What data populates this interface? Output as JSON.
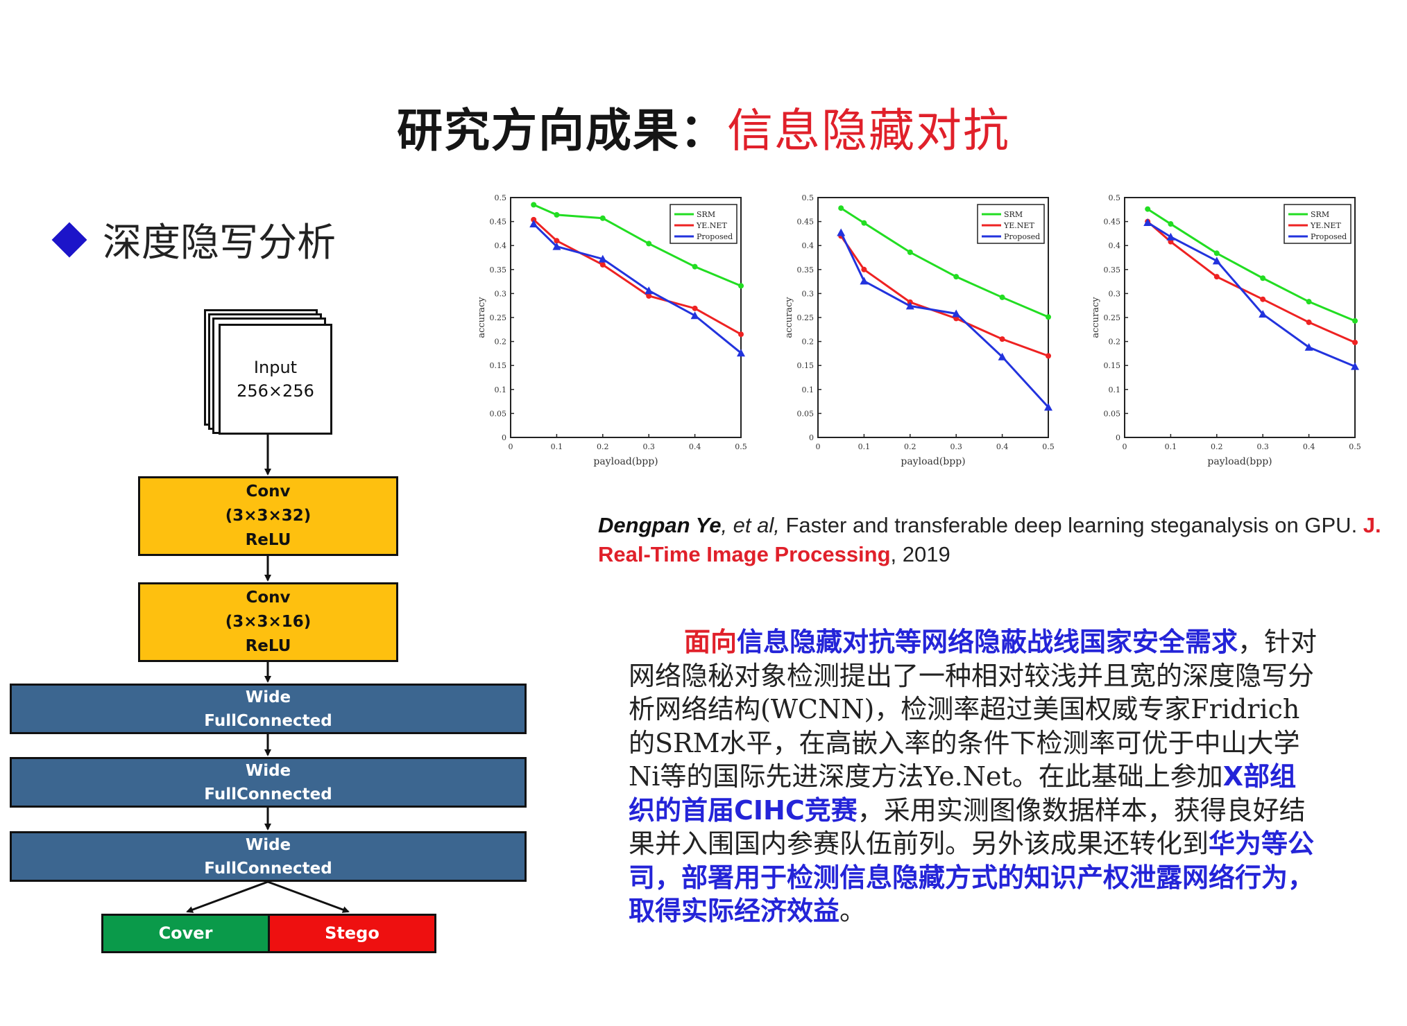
{
  "title": {
    "part1": "研究方向成果：",
    "part2": "信息隐藏对抗"
  },
  "section_heading": "深度隐写分析",
  "colors": {
    "title_red": "#e0202a",
    "bullet_blue": "#1c14c9",
    "conv_yellow": "#fec00f",
    "fc_blue": "#3c6690",
    "cover_green": "#0a9a4a",
    "stego_red": "#ee1010",
    "highlight_blue": "#2424d8"
  },
  "diagram": {
    "input": {
      "line1": "Input",
      "line2": "256×256"
    },
    "conv1": {
      "line1": "Conv",
      "line2": "(3×3×32)",
      "line3": "ReLU"
    },
    "conv2": {
      "line1": "Conv",
      "line2": "(3×3×16)",
      "line3": "ReLU"
    },
    "fc": [
      {
        "line1": "Wide",
        "line2": "FullConnected"
      },
      {
        "line1": "Wide",
        "line2": "FullConnected"
      },
      {
        "line1": "Wide",
        "line2": "FullConnected"
      }
    ],
    "outputs": {
      "cover": "Cover",
      "stego": "Stego"
    }
  },
  "chart_data": [
    {
      "type": "line",
      "xlabel": "payload(bpp)",
      "ylabel": "accuracy",
      "xlim": [
        0,
        0.5
      ],
      "ylim": [
        0,
        0.5
      ],
      "x_ticks": [
        "0",
        "0.1",
        "0.2",
        "0.3",
        "0.4",
        "0.5"
      ],
      "y_ticks": [
        "0",
        "0.05",
        "0.1",
        "0.15",
        "0.2",
        "0.25",
        "0.3",
        "0.35",
        "0.4",
        "0.45",
        "0.5"
      ],
      "legend_position": "top-right",
      "x": [
        0.05,
        0.1,
        0.2,
        0.3,
        0.4,
        0.5
      ],
      "series": [
        {
          "name": "SRM",
          "color": "#22dd22",
          "values": [
            0.485,
            0.464,
            0.457,
            0.404,
            0.356,
            0.316
          ]
        },
        {
          "name": "YE.NET",
          "color": "#ee2222",
          "values": [
            0.454,
            0.41,
            0.36,
            0.295,
            0.269,
            0.215
          ]
        },
        {
          "name": "Proposed",
          "color": "#2233dd",
          "values": [
            0.445,
            0.398,
            0.372,
            0.306,
            0.254,
            0.176
          ]
        }
      ]
    },
    {
      "type": "line",
      "xlabel": "payload(bpp)",
      "ylabel": "accuracy",
      "xlim": [
        0,
        0.5
      ],
      "ylim": [
        0,
        0.5
      ],
      "x_ticks": [
        "0",
        "0.1",
        "0.2",
        "0.3",
        "0.4",
        "0.5"
      ],
      "y_ticks": [
        "0",
        "0.05",
        "0.1",
        "0.15",
        "0.2",
        "0.25",
        "0.3",
        "0.35",
        "0.4",
        "0.45",
        "0.5"
      ],
      "legend_position": "top-right",
      "x": [
        0.05,
        0.1,
        0.2,
        0.3,
        0.4,
        0.5
      ],
      "series": [
        {
          "name": "SRM",
          "color": "#22dd22",
          "values": [
            0.478,
            0.447,
            0.386,
            0.335,
            0.292,
            0.251
          ]
        },
        {
          "name": "YE.NET",
          "color": "#ee2222",
          "values": [
            0.42,
            0.35,
            0.282,
            0.248,
            0.205,
            0.17
          ]
        },
        {
          "name": "Proposed",
          "color": "#2233dd",
          "values": [
            0.427,
            0.326,
            0.274,
            0.258,
            0.168,
            0.063
          ]
        }
      ]
    },
    {
      "type": "line",
      "xlabel": "payload(bpp)",
      "ylabel": "accuracy",
      "xlim": [
        0,
        0.5
      ],
      "ylim": [
        0,
        0.5
      ],
      "x_ticks": [
        "0",
        "0.1",
        "0.2",
        "0.3",
        "0.4",
        "0.5"
      ],
      "y_ticks": [
        "0",
        "0.05",
        "0.1",
        "0.15",
        "0.2",
        "0.25",
        "0.3",
        "0.35",
        "0.4",
        "0.45",
        "0.5"
      ],
      "legend_position": "top-right",
      "x": [
        0.05,
        0.1,
        0.2,
        0.3,
        0.4,
        0.5
      ],
      "series": [
        {
          "name": "SRM",
          "color": "#22dd22",
          "values": [
            0.476,
            0.445,
            0.384,
            0.332,
            0.283,
            0.243
          ]
        },
        {
          "name": "YE.NET",
          "color": "#ee2222",
          "values": [
            0.45,
            0.408,
            0.335,
            0.288,
            0.24,
            0.198
          ]
        },
        {
          "name": "Proposed",
          "color": "#2233dd",
          "values": [
            0.448,
            0.418,
            0.368,
            0.257,
            0.188,
            0.148
          ]
        }
      ]
    }
  ],
  "citation": {
    "author": "Dengpan Ye",
    "etal": ", et al,",
    "title_text": " Faster and transferable deep learning steganalysis on GPU.",
    "journal": " J. Real-Time Image Processing",
    "year": ", 2019"
  },
  "description": {
    "seg1": "面向",
    "seg2": "信息隐藏对抗等网络隐蔽战线国家安全需求",
    "seg3": "，针对网络隐秘对象检测提出了一种相对较浅并且宽的深度隐写分析网络结构(WCNN)，检测率超过美国权威专家Fridrich的SRM水平，在高嵌入率的条件下检测率可优于中山大学Ni等的国际先进深度方法Ye.Net。在此基础上参加",
    "seg4": "X部组织的首届CIHC竞赛",
    "seg5": "，采用实测图像数据样本，获得良好结果并入围国内参赛队伍前列。另外该成果还转化到",
    "seg6": "华为等公司，部署用于检测信息隐藏方式的知识产权泄露网络行为，取得实际经济效益",
    "seg7": "。"
  }
}
